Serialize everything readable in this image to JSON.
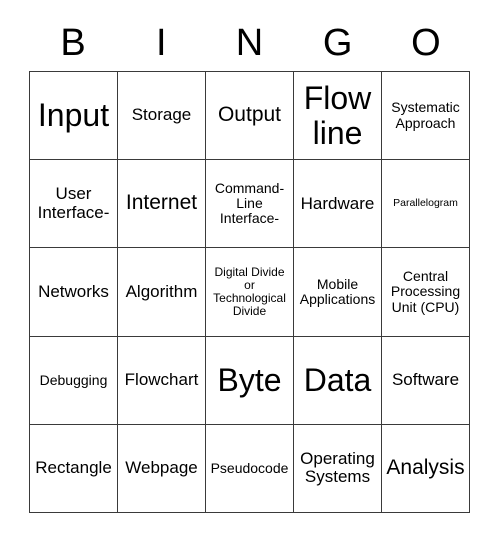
{
  "card": {
    "header_letters": [
      "B",
      "I",
      "N",
      "G",
      "O"
    ],
    "border_color": "#3a3a3a",
    "text_color": "#000000",
    "background_color": "#ffffff",
    "rows": [
      [
        {
          "label": "Input",
          "size": "xxl"
        },
        {
          "label": "Storage",
          "size": "md"
        },
        {
          "label": "Output",
          "size": "lg"
        },
        {
          "label": "Flow\nline",
          "size": "xxl"
        },
        {
          "label": "Systematic\nApproach",
          "size": "sm"
        }
      ],
      [
        {
          "label": "User\nInterface-",
          "size": "md"
        },
        {
          "label": "Internet",
          "size": "lg"
        },
        {
          "label": "Command-\nLine\nInterface-",
          "size": "sm"
        },
        {
          "label": "Hardware",
          "size": "md"
        },
        {
          "label": "Parallelogram",
          "size": "xxs"
        }
      ],
      [
        {
          "label": "Networks",
          "size": "md"
        },
        {
          "label": "Algorithm",
          "size": "md"
        },
        {
          "label": "Digital Divide\nor\nTechnological\nDivide",
          "size": "xs"
        },
        {
          "label": "Mobile\nApplications",
          "size": "sm"
        },
        {
          "label": "Central\nProcessing\nUnit (CPU)",
          "size": "sm"
        }
      ],
      [
        {
          "label": "Debugging",
          "size": "sm"
        },
        {
          "label": "Flowchart",
          "size": "md"
        },
        {
          "label": "Byte",
          "size": "xxl"
        },
        {
          "label": "Data",
          "size": "xxl"
        },
        {
          "label": "Software",
          "size": "md"
        }
      ],
      [
        {
          "label": "Rectangle",
          "size": "md"
        },
        {
          "label": "Webpage",
          "size": "md"
        },
        {
          "label": "Pseudocode",
          "size": "sm"
        },
        {
          "label": "Operating\nSystems",
          "size": "md"
        },
        {
          "label": "Analysis",
          "size": "lg"
        }
      ]
    ]
  }
}
